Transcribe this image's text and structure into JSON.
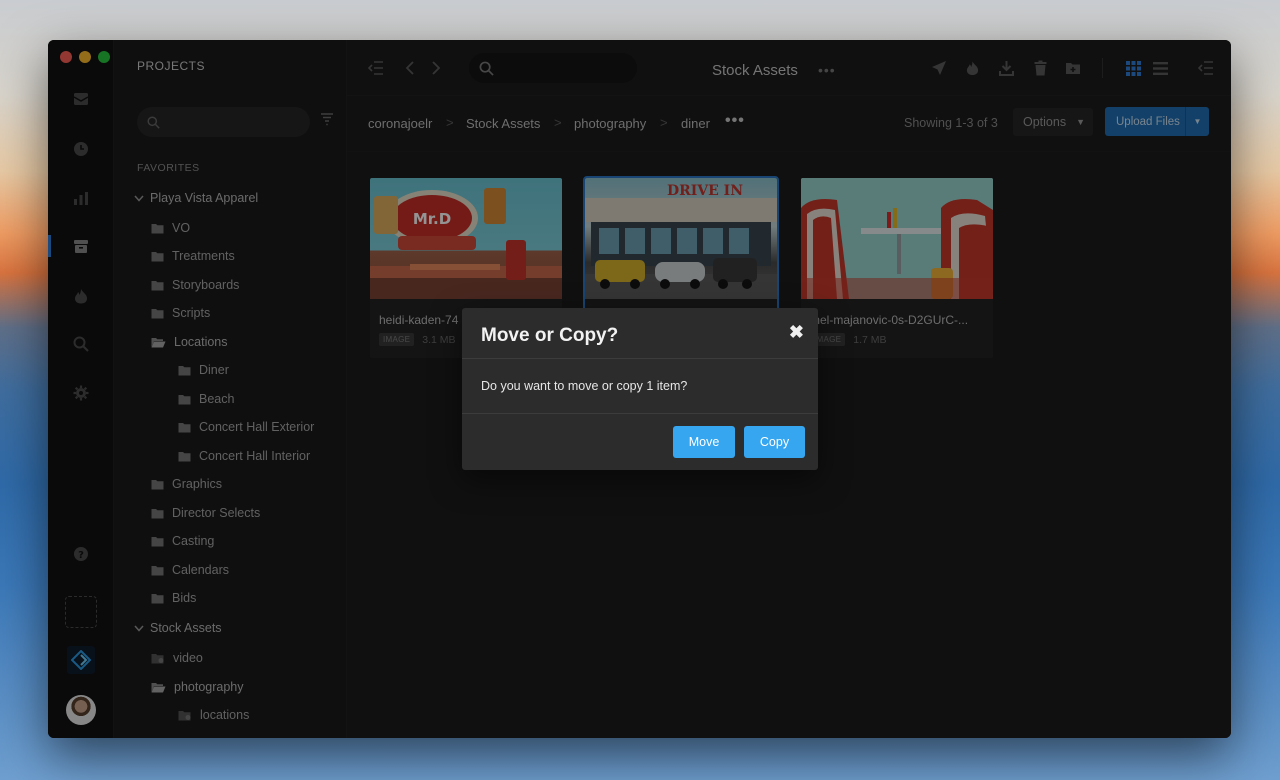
{
  "sidebar": {
    "title": "PROJECTS",
    "search_placeholder": "",
    "favorites_label": "FAVORITES",
    "tree": [
      {
        "label": "Playa Vista Apparel",
        "kind": "caret"
      },
      {
        "label": "VO",
        "kind": "folder"
      },
      {
        "label": "Treatments",
        "kind": "folder"
      },
      {
        "label": "Storyboards",
        "kind": "folder"
      },
      {
        "label": "Scripts",
        "kind": "folder"
      },
      {
        "label": "Locations",
        "kind": "folder-open"
      },
      {
        "label": "Diner",
        "kind": "folder"
      },
      {
        "label": "Beach",
        "kind": "folder"
      },
      {
        "label": "Concert Hall Exterior",
        "kind": "folder"
      },
      {
        "label": "Concert Hall Interior",
        "kind": "folder"
      },
      {
        "label": "Graphics",
        "kind": "folder"
      },
      {
        "label": "Director Selects",
        "kind": "folder"
      },
      {
        "label": "Casting",
        "kind": "folder"
      },
      {
        "label": "Calendars",
        "kind": "folder"
      },
      {
        "label": "Bids",
        "kind": "folder"
      },
      {
        "label": "Stock Assets",
        "kind": "caret"
      },
      {
        "label": "video",
        "kind": "folder-shared"
      },
      {
        "label": "photography",
        "kind": "folder-open"
      },
      {
        "label": "locations",
        "kind": "folder-shared"
      }
    ]
  },
  "toolbar": {
    "title": "Stock Assets",
    "more": "•••",
    "search_placeholder": ""
  },
  "breadcrumb": {
    "items": [
      "coronajoelr",
      "Stock Assets",
      "photography",
      "diner"
    ],
    "separator": ">",
    "more": "•••"
  },
  "listing": {
    "showing": "Showing 1-3 of 3",
    "options_label": "Options",
    "upload_label": "Upload Files"
  },
  "assets": [
    {
      "name": "heidi-kaden-74",
      "type": "IMAGE",
      "size": "3.1 MB"
    },
    {
      "name": "",
      "type": "IMAGE",
      "size": ""
    },
    {
      "name": "mel-majanovic-0s-D2GUrC-...",
      "type": "IMAGE",
      "size": "1.7 MB"
    }
  ],
  "modal": {
    "title": "Move or Copy?",
    "close": "✖",
    "body": "Do you want to move or copy 1 item?",
    "move_label": "Move",
    "copy_label": "Copy"
  },
  "colors": {
    "accent": "#36a6f0",
    "upload": "#206fb3",
    "selection": "#2a78c6"
  }
}
